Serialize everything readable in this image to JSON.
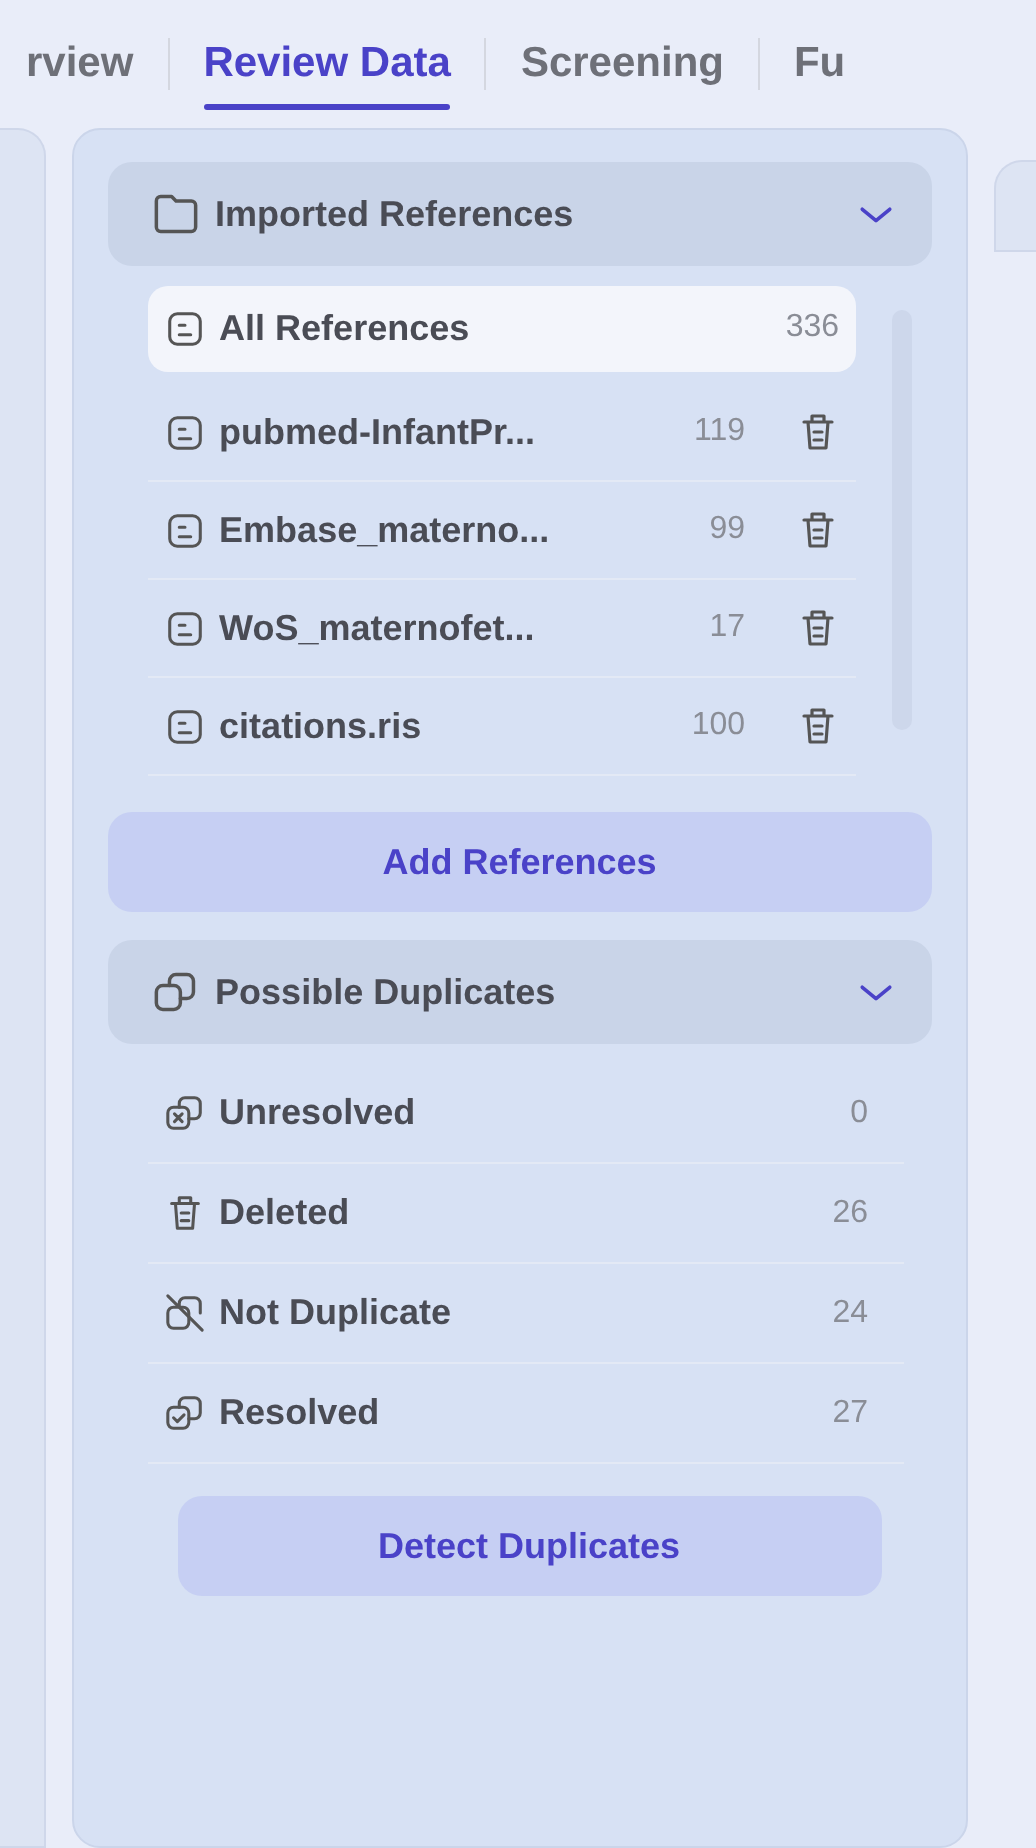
{
  "tabs": [
    {
      "label": "rview",
      "selected": false
    },
    {
      "label": "Review Data",
      "selected": true
    },
    {
      "label": "Screening",
      "selected": false
    },
    {
      "label": "Fu",
      "selected": false
    }
  ],
  "imported": {
    "title": "Imported References",
    "expanded": true,
    "items": [
      {
        "name": "All References",
        "count": "336",
        "selected": true,
        "deletable": false
      },
      {
        "name": "pubmed-InfantPr...",
        "count": "119",
        "selected": false,
        "deletable": true
      },
      {
        "name": "Embase_materno...",
        "count": "99",
        "selected": false,
        "deletable": true
      },
      {
        "name": "WoS_maternofet...",
        "count": "17",
        "selected": false,
        "deletable": true
      },
      {
        "name": "citations.ris",
        "count": "100",
        "selected": false,
        "deletable": true
      }
    ],
    "button": "Add References"
  },
  "duplicates": {
    "title": "Possible Duplicates",
    "expanded": true,
    "items": [
      {
        "kind": "unresolved",
        "name": "Unresolved",
        "count": "0"
      },
      {
        "kind": "deleted",
        "name": "Deleted",
        "count": "26"
      },
      {
        "kind": "not-duplicate",
        "name": "Not Duplicate",
        "count": "24"
      },
      {
        "kind": "resolved",
        "name": "Resolved",
        "count": "27"
      }
    ],
    "button": "Detect Duplicates"
  }
}
